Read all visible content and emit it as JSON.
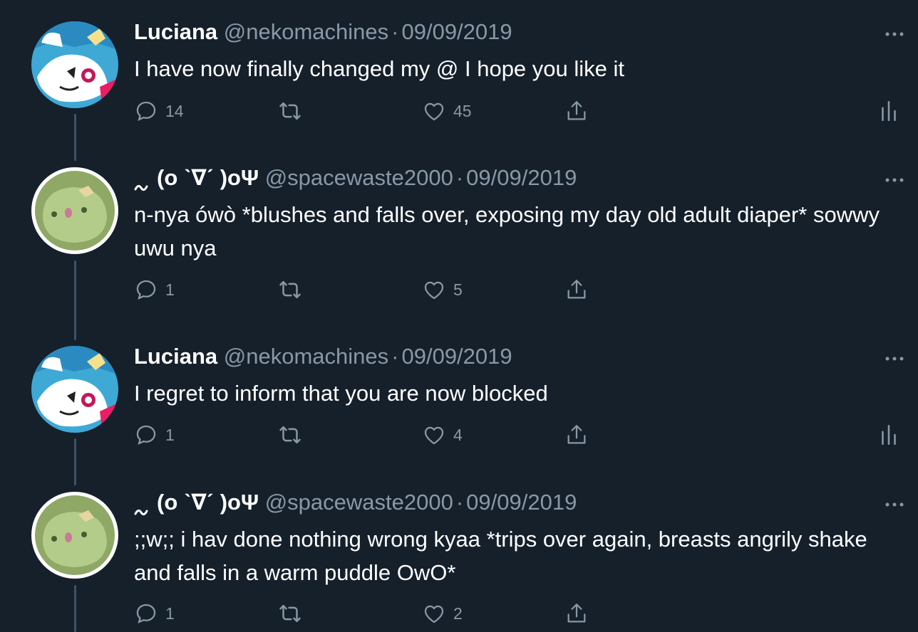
{
  "colors": {
    "background": "#15202b",
    "secondary_text": "#8899a6",
    "thread_line": "#3d5466",
    "primary_text": "#ffffff"
  },
  "tweets": [
    {
      "author": "Luciana",
      "handle": "@nekomachines",
      "separator": "·",
      "date": "09/09/2019",
      "text": "I have now finally changed my @ I hope you like it",
      "reply_count": "14",
      "retweet_count": "",
      "like_count": "45",
      "has_analytics": true,
      "avatar_icon": "anime-girl-avatar"
    },
    {
      "author": "(o ˋ∇ˊ )oΨ",
      "handle": "@spacewaste2000",
      "separator": "·",
      "date": "09/09/2019",
      "text": "n-nya ówò *blushes and falls over, exposing my day old adult diaper* sowwy uwu nya",
      "reply_count": "1",
      "retweet_count": "",
      "like_count": "5",
      "has_analytics": false,
      "avatar_icon": "green-blob-avatar"
    },
    {
      "author": "Luciana",
      "handle": "@nekomachines",
      "separator": "·",
      "date": "09/09/2019",
      "text": "I regret to inform that you are now blocked",
      "reply_count": "1",
      "retweet_count": "",
      "like_count": "4",
      "has_analytics": true,
      "avatar_icon": "anime-girl-avatar"
    },
    {
      "author": "(o ˋ∇ˊ )oΨ",
      "handle": "@spacewaste2000",
      "separator": "·",
      "date": "09/09/2019",
      "text": ";;w;; i hav done nothing wrong kyaa *trips over again, breasts angrily shake and falls in a warm puddle OwO*",
      "reply_count": "1",
      "retweet_count": "",
      "like_count": "2",
      "has_analytics": false,
      "avatar_icon": "green-blob-avatar"
    }
  ]
}
